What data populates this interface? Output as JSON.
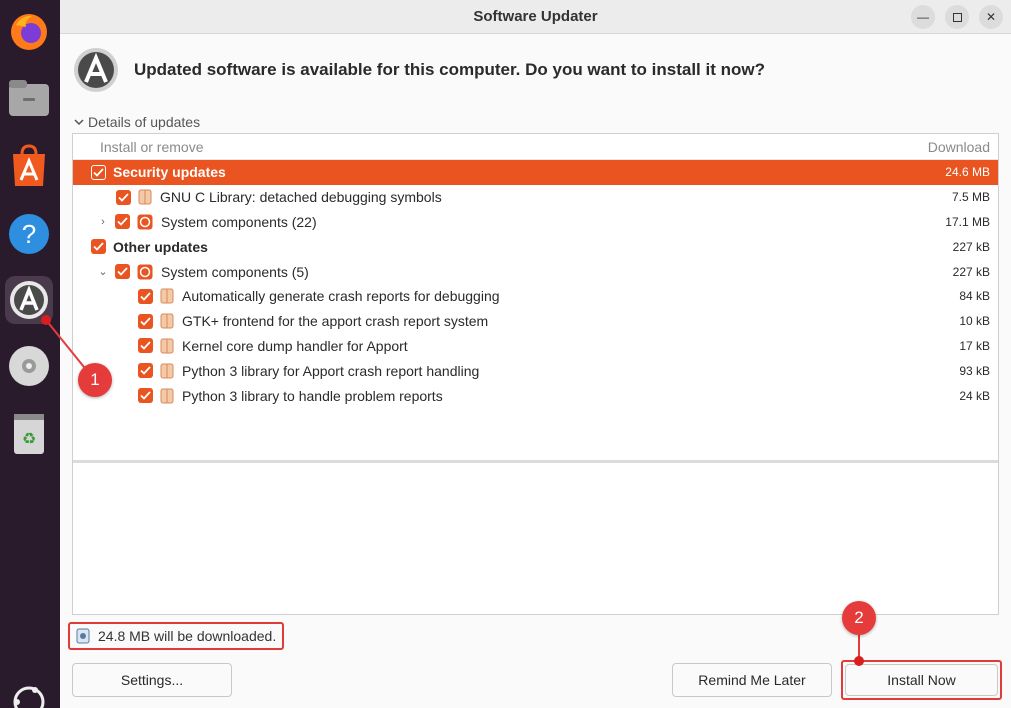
{
  "window": {
    "title": "Software Updater"
  },
  "header": {
    "message": "Updated software is available for this computer. Do you want to install it now?"
  },
  "details": {
    "toggle_label": "Details of updates"
  },
  "list": {
    "col_name": "Install or remove",
    "col_size": "Download",
    "rows": [
      {
        "label": "Security updates",
        "size": "24.6 MB"
      },
      {
        "label": "GNU C Library: detached debugging symbols",
        "size": "7.5 MB"
      },
      {
        "label": "System components (22)",
        "size": "17.1 MB"
      },
      {
        "label": "Other updates",
        "size": "227 kB"
      },
      {
        "label": "System components (5)",
        "size": "227 kB"
      },
      {
        "label": "Automatically generate crash reports for debugging",
        "size": "84 kB"
      },
      {
        "label": "GTK+ frontend for the apport crash report system",
        "size": "10 kB"
      },
      {
        "label": "Kernel core dump handler for Apport",
        "size": "17 kB"
      },
      {
        "label": "Python 3 library for Apport crash report handling",
        "size": "93 kB"
      },
      {
        "label": "Python 3 library to handle problem reports",
        "size": "24 kB"
      }
    ]
  },
  "status": {
    "download_text": "24.8 MB will be downloaded."
  },
  "buttons": {
    "settings": "Settings...",
    "remind": "Remind Me Later",
    "install": "Install Now"
  },
  "annotations": {
    "callout_1": "1",
    "callout_2": "2"
  },
  "colors": {
    "accent": "#e95420",
    "callout": "#e53b3b",
    "dock": "#2a1b2c"
  },
  "dock_icons": [
    "firefox-icon",
    "files-icon",
    "app-center-icon",
    "help-icon",
    "software-updater-icon",
    "dvd-icon",
    "trash-icon",
    "ubuntu-logo-icon"
  ]
}
